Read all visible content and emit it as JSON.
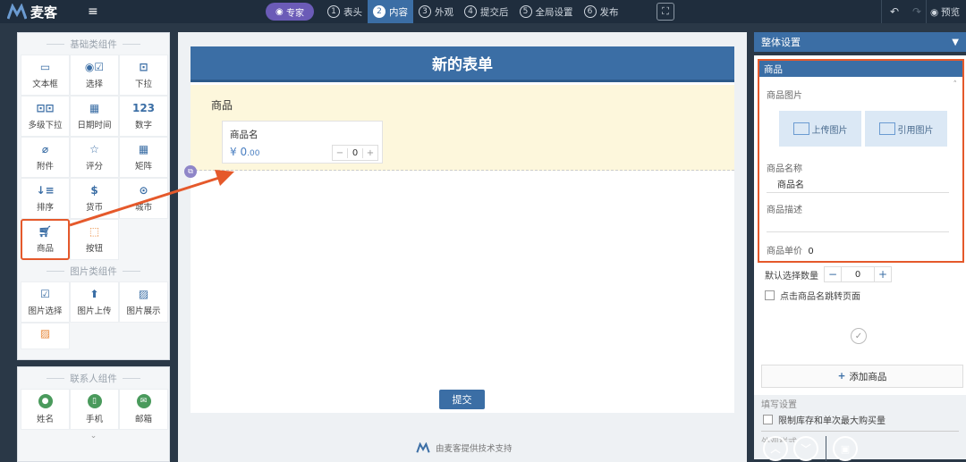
{
  "app": {
    "brand": "麦客"
  },
  "topbar": {
    "mode_label": "专家",
    "steps": [
      {
        "num": "1",
        "label": "表头"
      },
      {
        "num": "2",
        "label": "内容"
      },
      {
        "num": "3",
        "label": "外观"
      },
      {
        "num": "4",
        "label": "提交后"
      },
      {
        "num": "5",
        "label": "全局设置"
      },
      {
        "num": "6",
        "label": "发布"
      }
    ],
    "preview_label": "预览"
  },
  "left": {
    "basic_title": "基础类组件",
    "basic_items": [
      {
        "label": "文本框",
        "icon": "textbox-icon"
      },
      {
        "label": "选择",
        "icon": "choice-icon"
      },
      {
        "label": "下拉",
        "icon": "dropdown-icon"
      },
      {
        "label": "多级下拉",
        "icon": "multi-dropdown-icon"
      },
      {
        "label": "日期时间",
        "icon": "calendar-icon"
      },
      {
        "label": "数字",
        "icon": "number-icon"
      },
      {
        "label": "附件",
        "icon": "paperclip-icon"
      },
      {
        "label": "评分",
        "icon": "star-icon"
      },
      {
        "label": "矩阵",
        "icon": "matrix-icon"
      },
      {
        "label": "排序",
        "icon": "sort-icon"
      },
      {
        "label": "货币",
        "icon": "currency-icon"
      },
      {
        "label": "城市",
        "icon": "location-icon"
      },
      {
        "label": "商品",
        "icon": "cart-icon"
      },
      {
        "label": "按钮",
        "icon": "button-icon"
      }
    ],
    "image_title": "图片类组件",
    "image_items": [
      {
        "label": "图片选择",
        "icon": "image-select-icon"
      },
      {
        "label": "图片上传",
        "icon": "image-upload-icon"
      },
      {
        "label": "图片展示",
        "icon": "image-display-icon"
      }
    ],
    "contact_title": "联系人组件",
    "contact_items": [
      {
        "label": "姓名",
        "icon": "person-icon"
      },
      {
        "label": "手机",
        "icon": "phone-icon"
      },
      {
        "label": "邮箱",
        "icon": "mail-icon"
      }
    ]
  },
  "form": {
    "title": "新的表单",
    "product_section_label": "商品",
    "product_name": "商品名",
    "price_symbol": "¥",
    "price_int": "0",
    "price_dec": ".00",
    "qty": "0",
    "submit_label": "提交",
    "footer": "由麦客提供技术支持"
  },
  "right": {
    "header": "整体设置",
    "box_title": "商品",
    "image_label": "商品图片",
    "upload_label": "上传图片",
    "ref_label": "引用图片",
    "name_label": "商品名称",
    "name_value": "商品名",
    "desc_label": "商品描述",
    "price_label": "商品单价",
    "price_value": "0",
    "default_qty_label": "默认选择数量",
    "default_qty_value": "0",
    "jump_label": "点击商品名跳转页面",
    "add_product_label": "添加商品",
    "fill_settings_label": "填写设置",
    "limit_label": "限制库存和单次最大购买量",
    "more_label": "外观样式"
  },
  "colors": {
    "accent": "#3b6ea5",
    "highlight": "#e5592b",
    "topbar": "#1f2d3d"
  }
}
